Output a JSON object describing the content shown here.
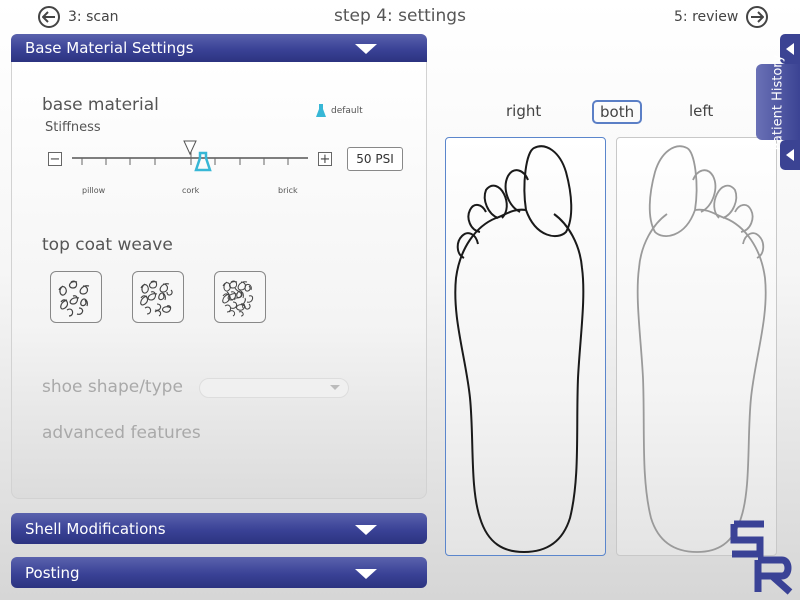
{
  "nav": {
    "back_label": "3: scan",
    "title": "step 4: settings",
    "next_label": "5: review"
  },
  "base_panel": {
    "header": "Base Material Settings",
    "base_material_title": "base material",
    "stiffness_label": "Stiffness",
    "default_label": "default",
    "minus_label": "−",
    "plus_label": "+",
    "psi_value": "50 PSI",
    "slider_labels": [
      "pillow",
      "cork",
      "brick"
    ],
    "top_coat_title": "top coat weave",
    "weave_options": [
      "weave-light-icon",
      "weave-medium-icon",
      "weave-dense-icon"
    ],
    "shoe_shape_label": "shoe shape/type",
    "shoe_shape_value": "",
    "advanced_label": "advanced features"
  },
  "shell_panel": {
    "header": "Shell Modifications"
  },
  "posting_panel": {
    "header": "Posting"
  },
  "foot_selector": {
    "right_label": "right",
    "both_label": "both",
    "left_label": "left",
    "selected": "both"
  },
  "history_tab": {
    "label": "Patient History"
  },
  "logo": {
    "text": "SR"
  },
  "colors": {
    "accent": "#3a4296",
    "selection": "#5b7fc6",
    "marker": "#37b7d6"
  }
}
